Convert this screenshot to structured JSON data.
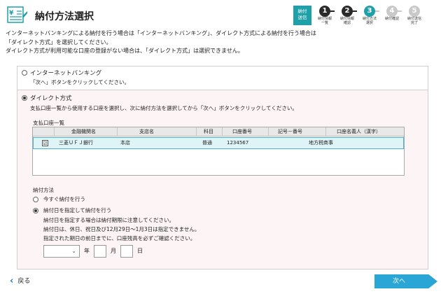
{
  "header": {
    "title": "納付方法選択",
    "logo_icon": "yen-document-icon"
  },
  "steps": {
    "current_badge": [
      "納付",
      "送信"
    ],
    "items": [
      {
        "num": "1",
        "label": [
          "納付情報",
          "一覧"
        ],
        "state": "done"
      },
      {
        "num": "2",
        "label": [
          "納付情報",
          "確認"
        ],
        "state": "done"
      },
      {
        "num": "3",
        "label": [
          "納付方法",
          "選択"
        ],
        "state": "current"
      },
      {
        "num": "4",
        "label": [
          "納付確認"
        ],
        "state": "todo"
      },
      {
        "num": "5",
        "label": [
          "納付送信",
          "完了"
        ],
        "state": "todo"
      }
    ],
    "colors": {
      "done": "#2a2a2a",
      "current": "#1fa0a9",
      "todo": "#c9c9c9"
    }
  },
  "intro": {
    "line1": "インターネットバンキングによる納付を行う場合は「インターネットバンキング」、ダイレクト方式による納付を行う場合は",
    "line2": "「ダイレクト方式」を選択してください。",
    "line3": "ダイレクト方式が利用可能な口座の登録がない場合は、「ダイレクト方式」は選択できません。"
  },
  "option_ib": {
    "label": "インターネットバンキング",
    "desc": "「次へ」ボタンをクリックしてください。",
    "selected": false
  },
  "option_direct": {
    "label": "ダイレクト方式",
    "desc": "支払口座一覧から使用する口座を選択し、次に納付方法を選択してから「次へ」ボタンをクリックしてください。",
    "selected": true
  },
  "account_list": {
    "title": "支払口座一覧",
    "headers": [
      "金融機関名",
      "支店名",
      "科目",
      "口座番号",
      "記号－番号",
      "口座名義人（漢字）"
    ],
    "rows": [
      {
        "checked": true,
        "check_mark": "☑",
        "bank": "三菱ＵＦＪ銀行",
        "branch": "本店",
        "type": "普通",
        "number": "1234567",
        "symbol": "",
        "holder": "地方税商事"
      }
    ]
  },
  "payment_method": {
    "title": "納付方法",
    "now_label": "今すぐ納付を行う",
    "now_selected": false,
    "date_label": "納付日を指定して納付を行う",
    "date_selected": true,
    "notes": [
      "納付日を指定する場合は納付期限に注意してください。",
      "納付日は、休日、祝日及び12月29日～1月3日は指定できません。",
      "指定された期日の前日までに、口座残高を必ずご確認ください。"
    ],
    "year_unit": "年",
    "month_unit": "月",
    "day_unit": "日",
    "year_value": "",
    "month_value": "",
    "day_value": ""
  },
  "footer": {
    "back_label": "戻る",
    "next_label": "次へ",
    "accent": "#2aa6d6"
  }
}
